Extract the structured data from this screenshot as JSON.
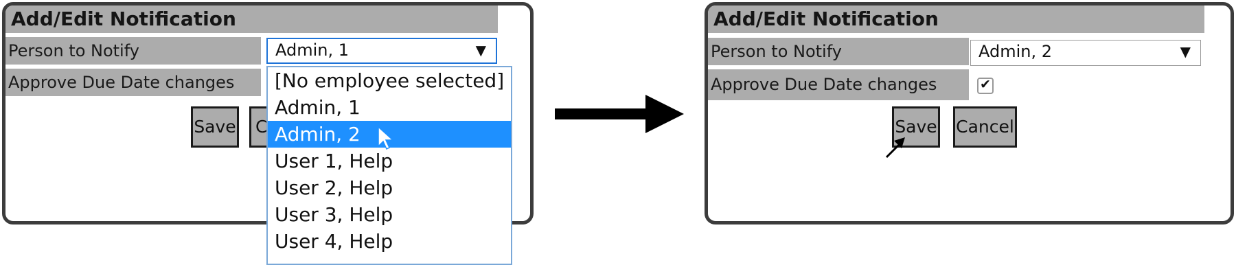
{
  "left_panel": {
    "title": "Add/Edit Notification",
    "person_label": "Person to Notify",
    "approve_label": "Approve Due Date changes",
    "select_value": "Admin, 1",
    "select_arrow": "▼",
    "save_label": "Save",
    "cancel_label_visible": "C",
    "dropdown_options": [
      "[No employee selected]",
      "Admin, 1",
      "Admin, 2",
      "User 1, Help",
      "User 2, Help",
      "User 3, Help",
      "User 4, Help"
    ],
    "highlighted_option": "Admin, 2"
  },
  "right_panel": {
    "title": "Add/Edit Notification",
    "person_label": "Person to Notify",
    "approve_label": "Approve Due Date changes",
    "select_value": "Admin, 2",
    "select_arrow": "▼",
    "approve_checked": true,
    "check_mark": "✔",
    "save_label": "Save",
    "cancel_label": "Cancel"
  },
  "colors": {
    "panel_border": "#3c3c3c",
    "header_gray": "#acacac",
    "highlight_blue": "#1e90ff",
    "dropdown_border": "#7aa8d8"
  },
  "icons": [
    "arrow-right-icon",
    "mouse-cursor-icon",
    "checkmark-icon",
    "dropdown-arrow-icon"
  ]
}
